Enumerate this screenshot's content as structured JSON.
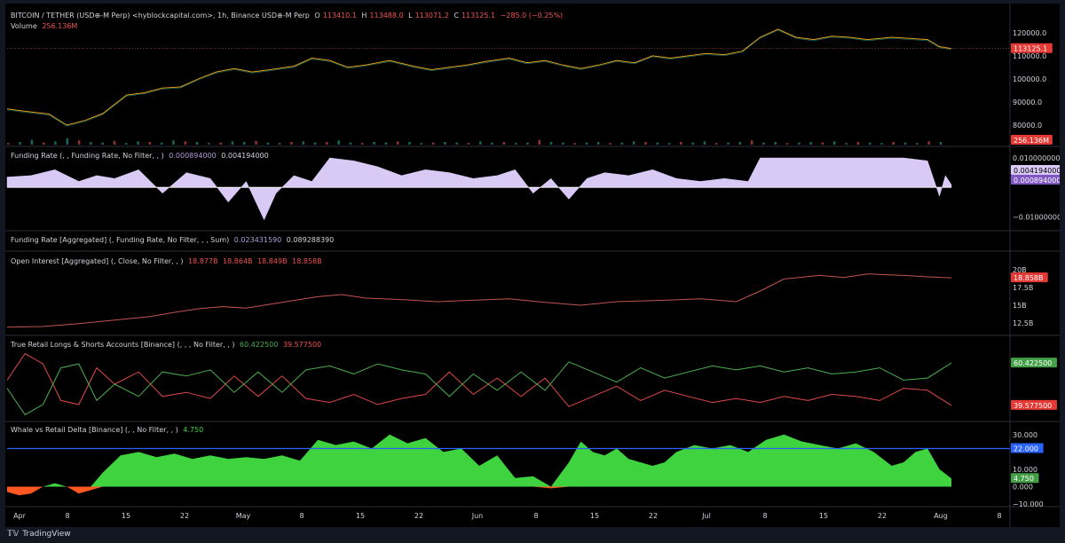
{
  "header": {
    "symbol": "BITCOIN / TETHER (USD⊕-M Perp) <hyblockcapital.com>, 1h, Binance USD⊕-M Perp",
    "o_label": "O",
    "o_value": "113410.1",
    "h_label": "H",
    "h_value": "113488.0",
    "l_label": "L",
    "l_value": "113071.2",
    "c_label": "C",
    "c_value": "113125.1",
    "change": "−285.0 (−0.25%)",
    "volume_label": "Volume",
    "volume_value": "256.136M"
  },
  "footer": {
    "brand": "TradingView"
  },
  "colors": {
    "background": "#000000",
    "up": "#26a69a",
    "down": "#ef5350",
    "price_line": "#e0a31a",
    "funding_fill": "#d9c9f5",
    "oi_line": "#c0544f",
    "longs": "#4caf50",
    "shorts": "#e04848",
    "delta_pos": "#3fd33f",
    "delta_neg": "#ff5722",
    "level_line": "#2962ff",
    "axis_text": "#d1d4dc"
  },
  "chart_data": [
    {
      "type": "line",
      "name": "price",
      "title": "",
      "xlabel": "",
      "ylabel": "",
      "ylim": [
        75000,
        128000
      ],
      "yticks": [
        "120000.0",
        "110000.0",
        "100000.0",
        "90000.0",
        "80000.0"
      ],
      "ytick_values": [
        120000,
        110000,
        100000,
        90000,
        80000
      ],
      "last_label": "113125.1",
      "volume_label": "256.136M",
      "points": [
        [
          0,
          87000
        ],
        [
          3,
          86000
        ],
        [
          7,
          84800
        ],
        [
          10,
          80000
        ],
        [
          13,
          82000
        ],
        [
          16,
          85000
        ],
        [
          20,
          93000
        ],
        [
          23,
          94000
        ],
        [
          26,
          96000
        ],
        [
          29,
          96500
        ],
        [
          32,
          100000
        ],
        [
          35,
          103000
        ],
        [
          38,
          104500
        ],
        [
          41,
          103000
        ],
        [
          44,
          104000
        ],
        [
          48,
          105500
        ],
        [
          51,
          109000
        ],
        [
          54,
          108000
        ],
        [
          57,
          105000
        ],
        [
          60,
          106000
        ],
        [
          64,
          108000
        ],
        [
          68,
          105500
        ],
        [
          71,
          104000
        ],
        [
          74,
          105000
        ],
        [
          77,
          106000
        ],
        [
          80,
          107500
        ],
        [
          84,
          109000
        ],
        [
          87,
          107000
        ],
        [
          90,
          108000
        ],
        [
          93,
          106000
        ],
        [
          96,
          104500
        ],
        [
          99,
          106000
        ],
        [
          102,
          108000
        ],
        [
          105,
          107000
        ],
        [
          108,
          110000
        ],
        [
          111,
          109000
        ],
        [
          114,
          110000
        ],
        [
          117,
          111000
        ],
        [
          120,
          110500
        ],
        [
          123,
          112000
        ],
        [
          126,
          118000
        ],
        [
          129,
          121500
        ],
        [
          132,
          118000
        ],
        [
          135,
          117000
        ],
        [
          138,
          118500
        ],
        [
          141,
          118000
        ],
        [
          144,
          117000
        ],
        [
          148,
          118000
        ],
        [
          151,
          117500
        ],
        [
          154,
          117000
        ],
        [
          156,
          114000
        ],
        [
          158,
          113125
        ]
      ]
    },
    {
      "type": "area",
      "name": "funding_rate",
      "title": "Funding Rate (, , Funding Rate, No Filter, , )",
      "legend_values": [
        "0.000894000",
        "0.004194000"
      ],
      "ylim": [
        -0.0135,
        0.0115
      ],
      "yticks": [
        "0.010000000",
        "−0.010000000"
      ],
      "ytick_values": [
        0.01,
        -0.01
      ],
      "current_labels": [
        "0.004194000",
        "0.000894000"
      ],
      "points": [
        [
          0,
          0.0035
        ],
        [
          4,
          0.004
        ],
        [
          8,
          0.006
        ],
        [
          12,
          0.002
        ],
        [
          15,
          0.004
        ],
        [
          18,
          0.003
        ],
        [
          22,
          0.006
        ],
        [
          26,
          -0.002
        ],
        [
          30,
          0.005
        ],
        [
          34,
          0.003
        ],
        [
          37,
          -0.005
        ],
        [
          40,
          0.002
        ],
        [
          43,
          -0.011
        ],
        [
          45,
          -0.002
        ],
        [
          48,
          0.004
        ],
        [
          51,
          0.002
        ],
        [
          54,
          0.01
        ],
        [
          58,
          0.009
        ],
        [
          62,
          0.007
        ],
        [
          66,
          0.004
        ],
        [
          70,
          0.006
        ],
        [
          74,
          0.005
        ],
        [
          78,
          0.003
        ],
        [
          82,
          0.004
        ],
        [
          85,
          0.006
        ],
        [
          88,
          -0.002
        ],
        [
          91,
          0.003
        ],
        [
          94,
          -0.004
        ],
        [
          97,
          0.003
        ],
        [
          100,
          0.005
        ],
        [
          104,
          0.004
        ],
        [
          108,
          0.006
        ],
        [
          112,
          0.003
        ],
        [
          116,
          0.002
        ],
        [
          120,
          0.003
        ],
        [
          124,
          0.002
        ],
        [
          126,
          0.01
        ],
        [
          130,
          0.01
        ],
        [
          135,
          0.01
        ],
        [
          140,
          0.01
        ],
        [
          145,
          0.01
        ],
        [
          150,
          0.01
        ],
        [
          154,
          0.009
        ],
        [
          156,
          -0.003
        ],
        [
          157,
          0.004
        ],
        [
          158,
          0.0009
        ]
      ]
    },
    {
      "type": "line",
      "name": "funding_rate_aggregated",
      "title": "Funding Rate [Aggregated] (, Funding Rate, No Filter, , , Sum)",
      "legend_values": [
        "0.023431590",
        "0.089288390"
      ]
    },
    {
      "type": "line",
      "name": "open_interest",
      "title": "Open Interest [Aggregated] (, Close, No Filter, , )",
      "legend_values": [
        "18.877B",
        "18.864B",
        "18.849B",
        "18.858B"
      ],
      "ylim": [
        11.5,
        20.5
      ],
      "yticks": [
        "20B",
        "17.5B",
        "15B",
        "12.5B"
      ],
      "ytick_values": [
        20,
        17.5,
        15,
        12.5
      ],
      "last_label": "18.858B",
      "points": [
        [
          0,
          11.9
        ],
        [
          6,
          12.0
        ],
        [
          12,
          12.4
        ],
        [
          18,
          12.9
        ],
        [
          24,
          13.4
        ],
        [
          28,
          14.0
        ],
        [
          32,
          14.5
        ],
        [
          36,
          14.8
        ],
        [
          40,
          14.6
        ],
        [
          46,
          15.4
        ],
        [
          52,
          16.2
        ],
        [
          56,
          16.5
        ],
        [
          60,
          16.0
        ],
        [
          66,
          15.8
        ],
        [
          72,
          15.5
        ],
        [
          78,
          15.7
        ],
        [
          84,
          15.9
        ],
        [
          90,
          15.4
        ],
        [
          96,
          15.0
        ],
        [
          102,
          15.5
        ],
        [
          110,
          15.7
        ],
        [
          116,
          15.9
        ],
        [
          122,
          15.5
        ],
        [
          126,
          17.0
        ],
        [
          130,
          18.7
        ],
        [
          136,
          19.2
        ],
        [
          140,
          18.9
        ],
        [
          144,
          19.4
        ],
        [
          150,
          19.2
        ],
        [
          154,
          19.0
        ],
        [
          158,
          18.858
        ]
      ]
    },
    {
      "type": "line",
      "name": "retail_longs_shorts",
      "title": "True Retail Longs & Shorts Accounts [Binance] (, , , No Filter, , )",
      "legend_values": [
        "60.422500",
        "39.577500"
      ],
      "ylim": [
        33,
        67
      ],
      "series": [
        {
          "values": [
            [
              0,
              48
            ],
            [
              3,
              35
            ],
            [
              6,
              40
            ],
            [
              9,
              58
            ],
            [
              12,
              60
            ],
            [
              15,
              42
            ],
            [
              18,
              50
            ],
            [
              22,
              44
            ],
            [
              26,
              56
            ],
            [
              30,
              54
            ],
            [
              34,
              57
            ],
            [
              38,
              46
            ],
            [
              42,
              56
            ],
            [
              46,
              46
            ],
            [
              50,
              57
            ],
            [
              54,
              59
            ],
            [
              58,
              55
            ],
            [
              62,
              60
            ],
            [
              66,
              57
            ],
            [
              70,
              55
            ],
            [
              74,
              44
            ],
            [
              78,
              55
            ],
            [
              82,
              47
            ],
            [
              86,
              56
            ],
            [
              90,
              47
            ],
            [
              94,
              61
            ],
            [
              98,
              56
            ],
            [
              102,
              51
            ],
            [
              106,
              58
            ],
            [
              110,
              53
            ],
            [
              114,
              56
            ],
            [
              118,
              59
            ],
            [
              122,
              57
            ],
            [
              126,
              59
            ],
            [
              130,
              56
            ],
            [
              134,
              58
            ],
            [
              138,
              55
            ],
            [
              142,
              56
            ],
            [
              146,
              58
            ],
            [
              150,
              52
            ],
            [
              154,
              53
            ],
            [
              158,
              60.42
            ]
          ]
        },
        {
          "values": [
            [
              0,
              52
            ],
            [
              3,
              65
            ],
            [
              6,
              60
            ],
            [
              9,
              42
            ],
            [
              12,
              40
            ],
            [
              15,
              58
            ],
            [
              18,
              50
            ],
            [
              22,
              56
            ],
            [
              26,
              44
            ],
            [
              30,
              46
            ],
            [
              34,
              43
            ],
            [
              38,
              54
            ],
            [
              42,
              44
            ],
            [
              46,
              54
            ],
            [
              50,
              43
            ],
            [
              54,
              41
            ],
            [
              58,
              45
            ],
            [
              62,
              40
            ],
            [
              66,
              43
            ],
            [
              70,
              45
            ],
            [
              74,
              56
            ],
            [
              78,
              45
            ],
            [
              82,
              53
            ],
            [
              86,
              44
            ],
            [
              90,
              53
            ],
            [
              94,
              39
            ],
            [
              98,
              44
            ],
            [
              102,
              49
            ],
            [
              106,
              42
            ],
            [
              110,
              47
            ],
            [
              114,
              44
            ],
            [
              118,
              41
            ],
            [
              122,
              43
            ],
            [
              126,
              41
            ],
            [
              130,
              44
            ],
            [
              134,
              42
            ],
            [
              138,
              45
            ],
            [
              142,
              44
            ],
            [
              146,
              42
            ],
            [
              150,
              48
            ],
            [
              154,
              47
            ],
            [
              158,
              39.58
            ]
          ]
        }
      ],
      "last_labels": [
        "60.422500",
        "39.577500"
      ]
    },
    {
      "type": "area",
      "name": "whale_vs_retail_delta",
      "title": "Whale vs Retail Delta [Binance] (, , No Filter, , )",
      "legend_values": [
        "4.750"
      ],
      "ylim": [
        -11,
        34
      ],
      "yticks": [
        "30.000",
        "10.000",
        "0.000",
        "−10.000"
      ],
      "ytick_values": [
        30,
        10,
        0,
        -10
      ],
      "level": 22,
      "level_label": "22.000",
      "last_label": "4.750",
      "points": [
        [
          0,
          -3
        ],
        [
          2,
          -5
        ],
        [
          4,
          -4
        ],
        [
          6,
          0
        ],
        [
          8,
          2
        ],
        [
          10,
          0
        ],
        [
          12,
          -4
        ],
        [
          14,
          -2
        ],
        [
          16,
          8
        ],
        [
          19,
          18
        ],
        [
          22,
          20
        ],
        [
          25,
          17
        ],
        [
          28,
          19
        ],
        [
          31,
          16
        ],
        [
          34,
          18
        ],
        [
          37,
          16
        ],
        [
          40,
          17
        ],
        [
          43,
          16
        ],
        [
          46,
          18
        ],
        [
          49,
          15
        ],
        [
          52,
          27
        ],
        [
          55,
          24
        ],
        [
          58,
          26
        ],
        [
          61,
          22
        ],
        [
          64,
          30
        ],
        [
          67,
          25
        ],
        [
          70,
          28
        ],
        [
          73,
          20
        ],
        [
          76,
          22
        ],
        [
          79,
          12
        ],
        [
          82,
          18
        ],
        [
          85,
          5
        ],
        [
          88,
          6
        ],
        [
          91,
          -1
        ],
        [
          94,
          14
        ],
        [
          96,
          26
        ],
        [
          98,
          20
        ],
        [
          100,
          18
        ],
        [
          102,
          22
        ],
        [
          104,
          16
        ],
        [
          106,
          14
        ],
        [
          108,
          12
        ],
        [
          110,
          14
        ],
        [
          112,
          20
        ],
        [
          115,
          24
        ],
        [
          118,
          22
        ],
        [
          121,
          24
        ],
        [
          124,
          20
        ],
        [
          127,
          27
        ],
        [
          130,
          30
        ],
        [
          133,
          26
        ],
        [
          136,
          24
        ],
        [
          139,
          22
        ],
        [
          142,
          25
        ],
        [
          145,
          20
        ],
        [
          148,
          12
        ],
        [
          150,
          14
        ],
        [
          152,
          20
        ],
        [
          154,
          22
        ],
        [
          156,
          10
        ],
        [
          158,
          4.75
        ]
      ]
    },
    {
      "type": "bar",
      "name": "volume",
      "values": [
        3,
        5,
        9,
        4,
        6,
        12,
        8,
        5,
        4,
        7,
        3,
        6,
        5,
        4,
        8,
        6,
        5,
        3,
        4,
        6,
        5,
        7,
        4,
        3,
        5,
        6,
        4,
        5,
        8,
        4,
        3,
        5,
        4,
        6,
        5,
        3,
        4,
        5,
        4,
        3,
        6,
        4,
        5,
        3,
        4,
        9,
        5,
        4,
        3,
        4,
        5,
        3,
        4,
        6,
        5,
        4,
        3,
        5,
        4,
        6,
        3,
        4,
        5,
        8,
        4,
        5,
        3,
        4,
        5,
        4,
        6,
        3,
        5,
        4,
        3,
        5,
        4,
        3,
        6,
        5
      ]
    }
  ],
  "xaxis": {
    "labels": [
      "Apr",
      "8",
      "15",
      "22",
      "May",
      "8",
      "15",
      "22",
      "Jun",
      "8",
      "15",
      "22",
      "Jul",
      "8",
      "15",
      "22",
      "Aug",
      "8"
    ],
    "positions": [
      1,
      10,
      21,
      32,
      43,
      54,
      65,
      76,
      87,
      98,
      109,
      120,
      130,
      141,
      152,
      163,
      174,
      185
    ]
  }
}
